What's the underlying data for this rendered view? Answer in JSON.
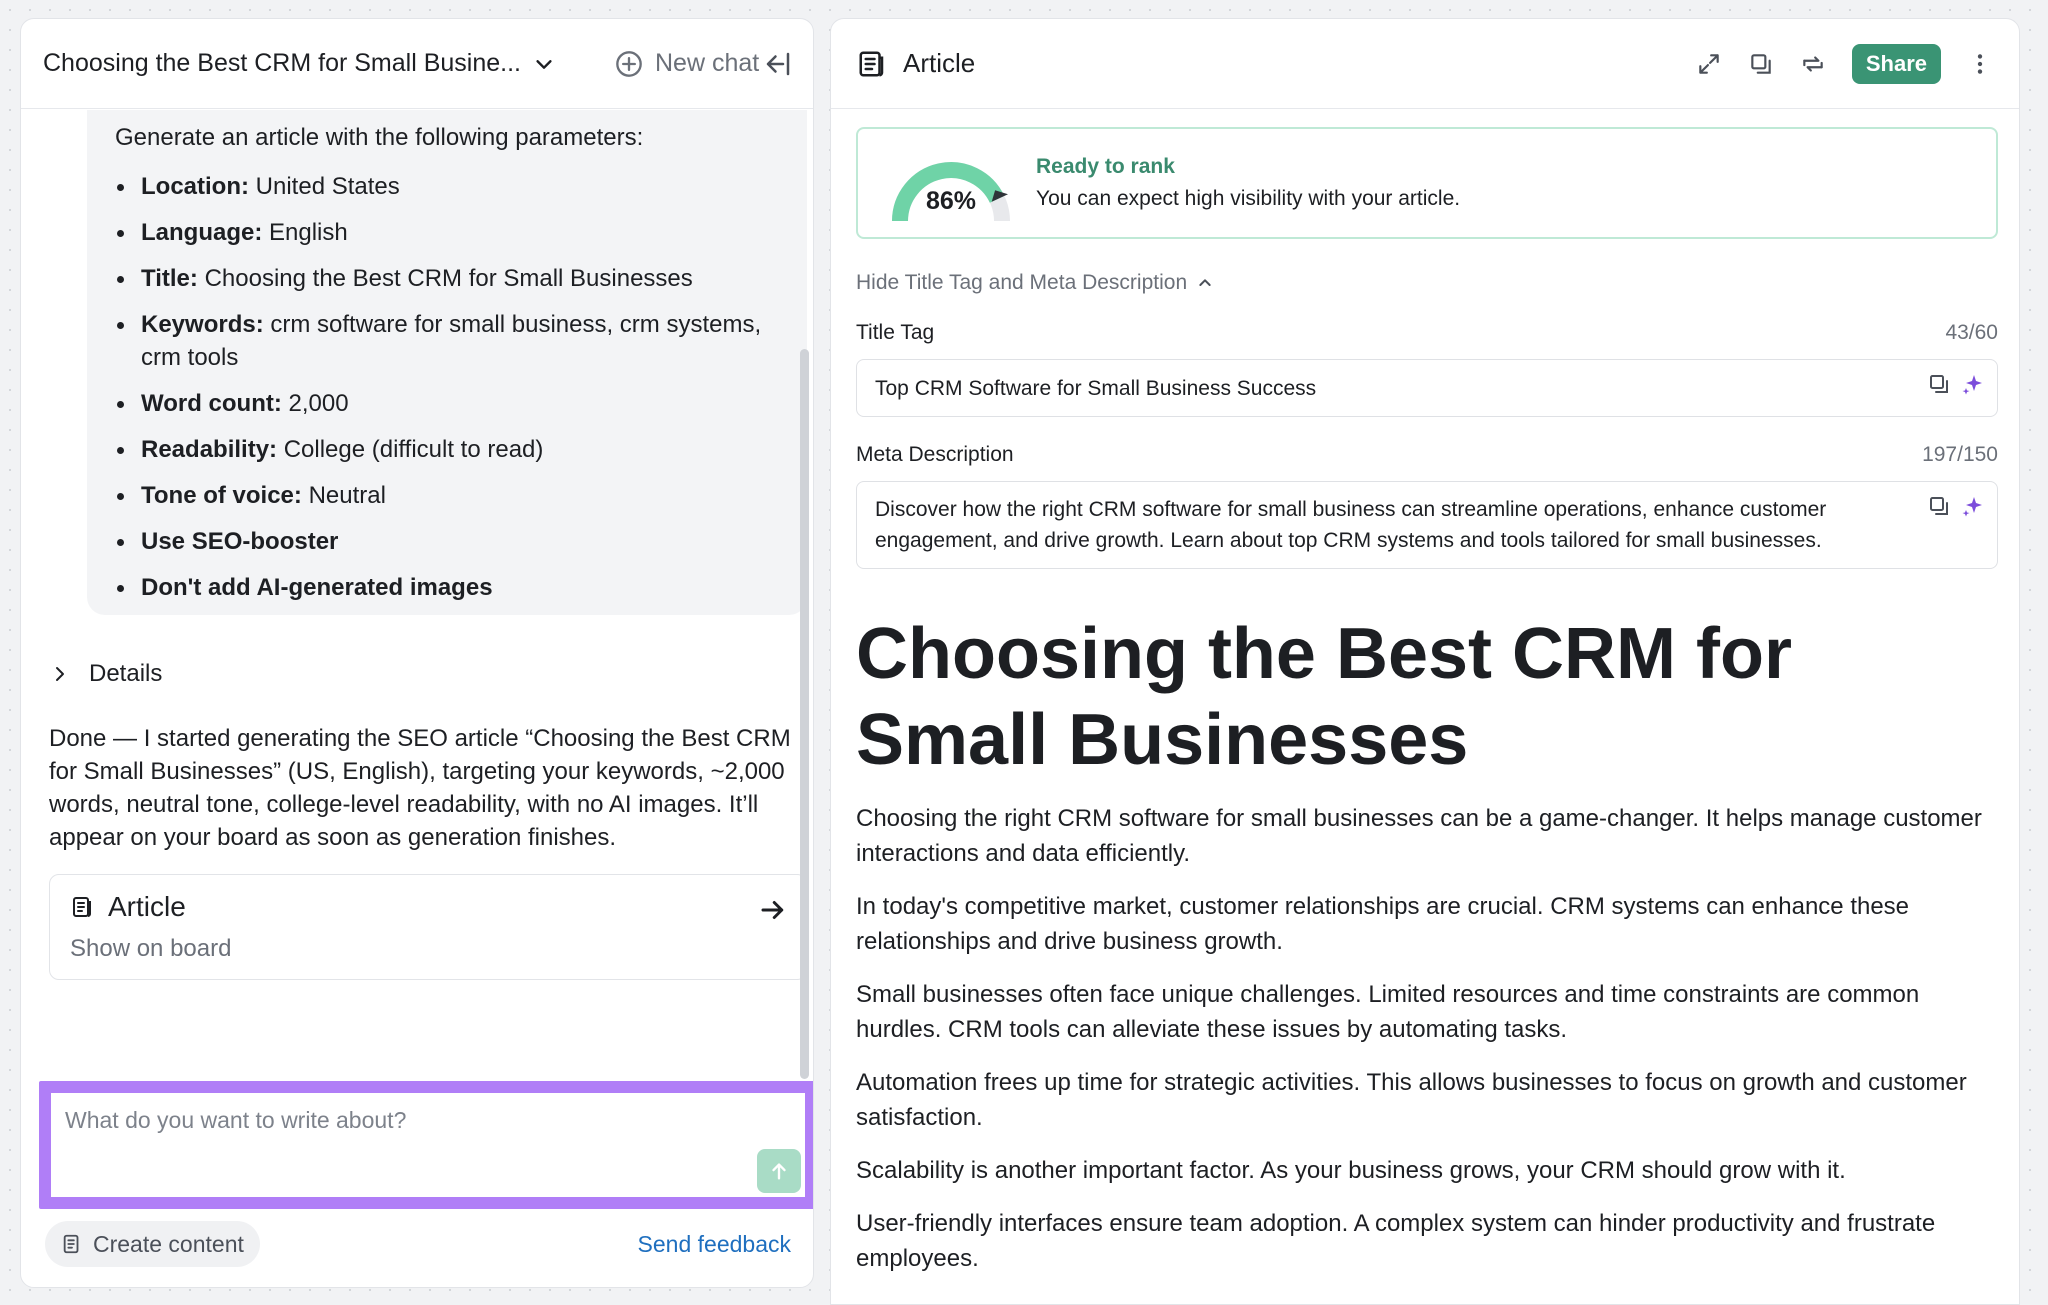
{
  "chat": {
    "title": "Choosing the Best CRM for Small Busine...",
    "new_chat": "New chat",
    "prompt_intro": "Generate an article with the following parameters:",
    "params": [
      {
        "label": "Location:",
        "value": " United States"
      },
      {
        "label": "Language:",
        "value": " English"
      },
      {
        "label": "Title:",
        "value": " Choosing the Best CRM for Small Businesses"
      },
      {
        "label": "Keywords:",
        "value": " crm software for small business, crm systems, crm tools"
      },
      {
        "label": "Word count:",
        "value": " 2,000"
      },
      {
        "label": "Readability:",
        "value": " College (difficult to read)"
      },
      {
        "label": "Tone of voice:",
        "value": " Neutral"
      },
      {
        "label": "Use SEO-booster",
        "value": ""
      },
      {
        "label": "Don't add AI-generated images",
        "value": ""
      }
    ],
    "details": "Details",
    "reply": "Done — I started generating the SEO article “Choosing the Best CRM for Small Businesses” (US, English), targeting your keywords, ~2,000 words, neutral tone, college-level readability, with no AI images. It’ll appear on your board as soon as generation finishes.",
    "article_card": {
      "title": "Article",
      "sub": "Show on board"
    },
    "input_placeholder": "What do you want to write about?",
    "create_content": "Create content",
    "send_feedback": "Send feedback"
  },
  "article": {
    "header_title": "Article",
    "share": "Share",
    "rank": {
      "percent": "86%",
      "value": 0.86,
      "title": "Ready to rank",
      "sub": "You can expect high visibility with your article."
    },
    "toggle_meta": "Hide Title Tag and Meta Description",
    "title_tag": {
      "label": "Title Tag",
      "count": "43/60",
      "value": "Top CRM Software for Small Business Success"
    },
    "meta": {
      "label": "Meta Description",
      "count": "197/150",
      "value": "Discover how the right CRM software for small business can streamline operations, enhance customer engagement, and drive growth. Learn about top CRM systems and tools tailored for small businesses."
    },
    "h1": "Choosing the Best CRM for Small Businesses",
    "paragraphs": [
      "Choosing the right CRM software for small businesses can be a game-changer. It helps manage customer interactions and data efficiently.",
      "In today's competitive market, customer relationships are crucial. CRM systems can enhance these relationships and drive business growth.",
      "Small businesses often face unique challenges. Limited resources and time constraints are common hurdles. CRM tools can alleviate these issues by automating tasks.",
      "Automation frees up time for strategic activities. This allows businesses to focus on growth and customer satisfaction.",
      "Scalability is another important factor. As your business grows, your CRM should grow with it.",
      "User-friendly interfaces ensure team adoption. A complex system can hinder productivity and frustrate employees."
    ]
  },
  "colors": {
    "accent_green": "#3a9474",
    "focus_purple": "#b07ef7",
    "link_blue": "#1f6fbf"
  }
}
